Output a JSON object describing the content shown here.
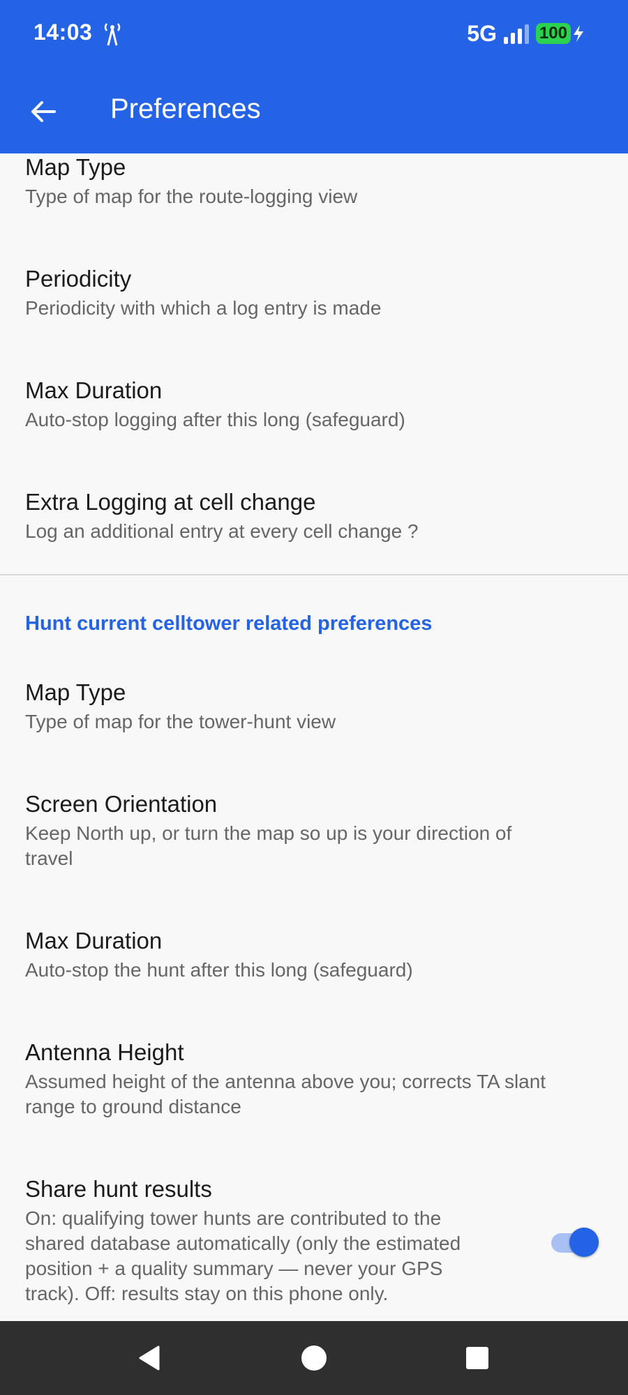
{
  "status_bar": {
    "time": "14:03",
    "network": "5G",
    "battery_level": "100",
    "icons": [
      "cell-tower-icon",
      "signal-icon",
      "battery-icon",
      "charging-bolt-icon"
    ],
    "accent_color": "#2563e6",
    "battery_color": "#2bd14f"
  },
  "app_bar": {
    "title": "Preferences",
    "back_icon": "arrow-back-icon"
  },
  "route_logging": {
    "items": [
      {
        "title": "Map Type",
        "summary": "Type of map for the route-logging view"
      },
      {
        "title": "Periodicity",
        "summary": "Periodicity with which a log entry is made"
      },
      {
        "title": "Max Duration",
        "summary": "Auto-stop logging after this long (safeguard)"
      },
      {
        "title": "Extra Logging at cell change",
        "summary": "Log an additional entry at every cell change ?"
      }
    ]
  },
  "hunt": {
    "header": "Hunt current celltower related preferences",
    "items": [
      {
        "title": "Map Type",
        "summary": "Type of map for the tower-hunt view"
      },
      {
        "title": "Screen Orientation",
        "summary_line1": "Keep North up, or turn the map so up is your direction of",
        "summary_line2": "travel"
      },
      {
        "title": "Max Duration",
        "summary": "Auto-stop the hunt after this long (safeguard)"
      },
      {
        "title": "Antenna Height",
        "summary_line1": "Assumed height of the antenna above you; corrects TA slant",
        "summary_line2": "range to ground distance"
      }
    ],
    "share": {
      "title": "Share hunt results",
      "summary_lines": [
        "On: qualifying tower hunts are contributed to the",
        "shared database automatically (only the estimated",
        "position + a quality summary — never your GPS",
        "track). Off: results stay on this phone only."
      ],
      "enabled": true
    }
  },
  "nav_bar": {
    "icons": [
      "nav-back-icon",
      "nav-home-icon",
      "nav-recents-icon"
    ]
  }
}
